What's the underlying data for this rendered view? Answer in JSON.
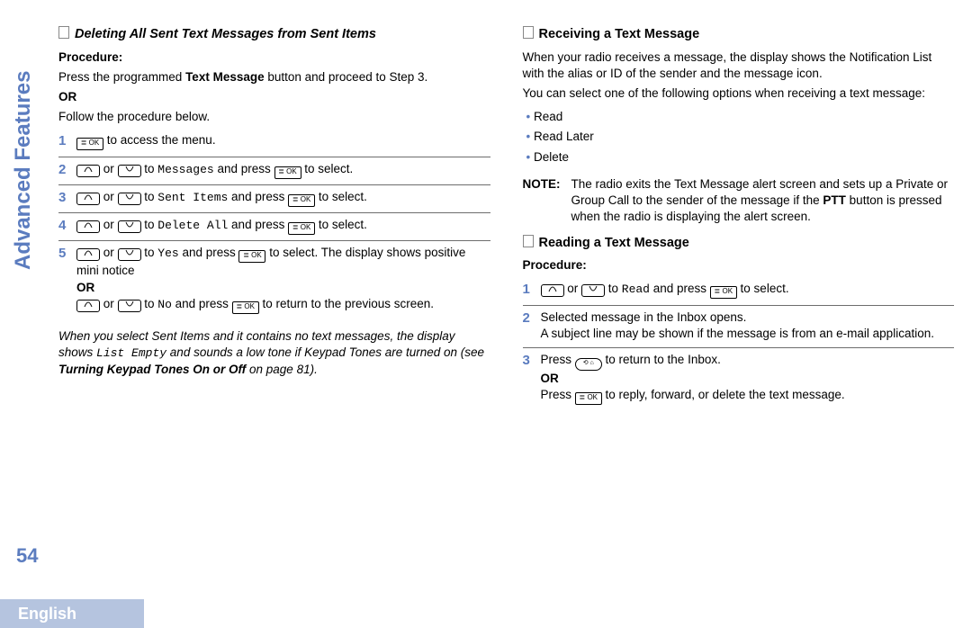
{
  "side_label": "Advanced Features",
  "page_number": "54",
  "footer_language": "English",
  "left": {
    "heading": "Deleting All Sent Text Messages from Sent Items",
    "procedure_label": "Procedure:",
    "intro1a": "Press the programmed ",
    "intro1_bold": "Text Message",
    "intro1b": " button and proceed to Step 3.",
    "or": "OR",
    "intro2": "Follow the procedure below.",
    "step1": " to access the menu.",
    "step2_pre": " or ",
    "step2_mid": " to ",
    "step2_target": "Messages",
    "step2_post": " and press ",
    "step2_end": " to select.",
    "step3_target": "Sent Items",
    "step4_target": "Delete All",
    "step5_target": "Yes",
    "step5_end": " to select. The display shows positive mini notice",
    "step5_or": "OR",
    "step5b_target": "No",
    "step5b_end": " to return to the previous screen.",
    "note_a": "When you select Sent Items and it contains no text messages, the display shows ",
    "note_mono": "List Empty",
    "note_b": " and sounds a low tone if Keypad Tones are turned on (see ",
    "note_bold": "Turning Keypad Tones On or Off",
    "note_c": " on page 81)."
  },
  "right": {
    "heading1": "Receiving a Text Message",
    "para1": "When your radio receives a message, the display shows the Notification List with the alias or ID of the sender and the message icon.",
    "para2": "You can select one of the following options when receiving a text message:",
    "opt1": "Read",
    "opt2": "Read Later",
    "opt3": "Delete",
    "note_label": "NOTE:",
    "note_a": "The radio exits the Text Message alert screen and sets up a Private or Group Call to the sender of the message if the ",
    "note_bold": "PTT",
    "note_b": " button is pressed when the radio is displaying the alert screen.",
    "heading2": "Reading a Text Message",
    "procedure_label": "Procedure:",
    "r_step1_target": "Read",
    "r_step1_end": " to select.",
    "r_step2a": "Selected message in the Inbox opens.",
    "r_step2b": "A subject line may be shown if the message is from an e-mail application.",
    "r_step3a": "Press ",
    "r_step3b": " to return to the Inbox.",
    "r_step3_or": "OR",
    "r_step3c": "Press ",
    "r_step3d": " to reply, forward, or delete the text message."
  },
  "keys": {
    "ok": "≣ OK",
    "back": "⟲ ⌂"
  }
}
